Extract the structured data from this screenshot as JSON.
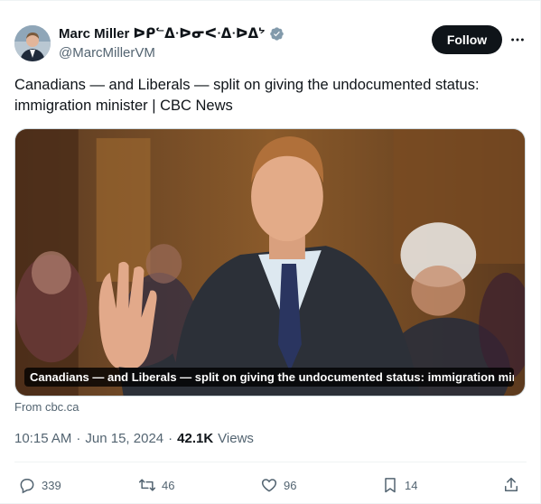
{
  "author": {
    "name": "Marc Miller ᐅᑭᓪᐃᐧᐅᓂᐸᐧᐃᐧᐅᐃᔾ",
    "handle": "@MarcMillerVM",
    "verified_icon": "verified-badge-icon"
  },
  "header": {
    "follow_label": "Follow",
    "more_icon": "more-options-icon"
  },
  "tweet": {
    "text": "Canadians — and Liberals — split on giving the undocumented status: immigration minister | CBC News"
  },
  "link_card": {
    "caption": "Canadians — and Liberals — split on giving the undocumented status: immigration mini...",
    "source": "From cbc.ca"
  },
  "meta": {
    "time": "10:15 AM",
    "separator": "·",
    "date": "Jun 15, 2024",
    "views_count": "42.1K",
    "views_label": "Views"
  },
  "actions": {
    "replies": "339",
    "reposts": "46",
    "likes": "96",
    "bookmarks": "14"
  },
  "colors": {
    "text": "#0f1419",
    "secondary": "#536471",
    "verified": "#829aab",
    "follow_bg": "#0f1419"
  }
}
